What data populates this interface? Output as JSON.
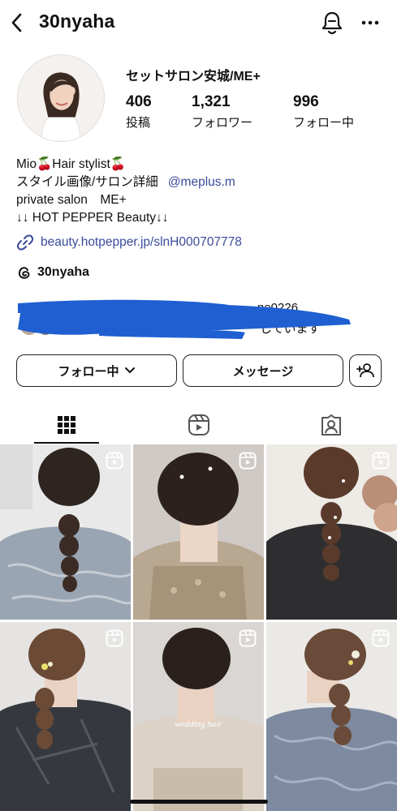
{
  "header": {
    "username": "30nyaha"
  },
  "profile": {
    "display_name": "セットサロン安城/ME+",
    "stats": [
      {
        "value": "406",
        "label": "投稿"
      },
      {
        "value": "1,321",
        "label": "フォロワー"
      },
      {
        "value": "996",
        "label": "フォロー中"
      }
    ],
    "bio_lines": [
      "Mio🍒Hair stylist🍒",
      "スタイル画像/サロン詳細",
      "private salon　ME+",
      "↓↓ HOT PEPPER  Beauty↓↓"
    ],
    "mention": "@meplus.m",
    "link": "beauty.hotpepper.jp/slnH000707778",
    "threads_handle": "30nyaha"
  },
  "mutual_followers": {
    "visible_fragment_1": "ne0226",
    "visible_fragment_2": "しています"
  },
  "actions": {
    "following_label": "フォロー中",
    "message_label": "メッセージ"
  },
  "colors": {
    "link": "#3b4b9a",
    "redaction": "#1f5fd1",
    "text": "#111111"
  },
  "tabs": [
    {
      "name": "grid",
      "icon": "grid-icon",
      "active": true
    },
    {
      "name": "reels",
      "icon": "reels-icon",
      "active": false
    },
    {
      "name": "tagged",
      "icon": "tagged-icon",
      "active": false
    }
  ],
  "posts": [
    {
      "type": "reel",
      "caption": ""
    },
    {
      "type": "reel",
      "caption": ""
    },
    {
      "type": "reel",
      "caption": ""
    },
    {
      "type": "reel",
      "caption": ""
    },
    {
      "type": "reel",
      "caption": "wedding hair"
    },
    {
      "type": "reel",
      "caption": ""
    }
  ]
}
